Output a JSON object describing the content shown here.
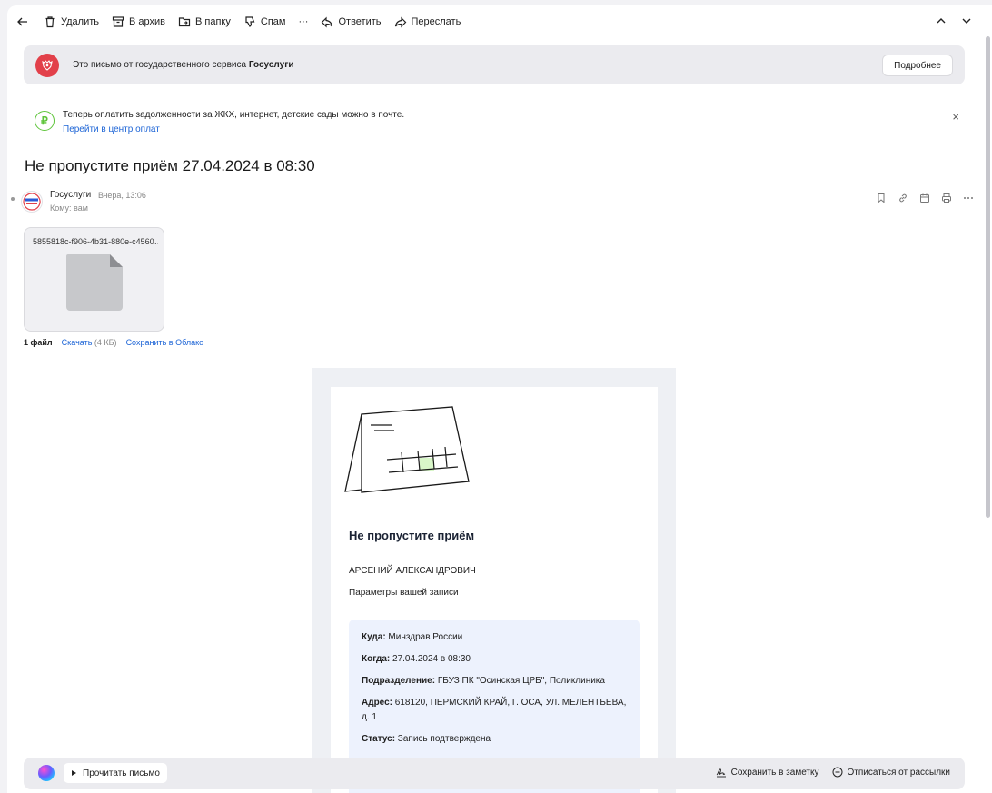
{
  "toolbar": {
    "delete": "Удалить",
    "archive": "В архив",
    "to_folder": "В папку",
    "spam": "Спам",
    "more": "···",
    "reply": "Ответить",
    "forward": "Переслать"
  },
  "gos_banner": {
    "text_prefix": "Это письмо от государственного сервиса",
    "text_brand": "Госуслуги",
    "more_button": "Подробнее"
  },
  "pay_banner": {
    "text": "Теперь оплатить задолженности за ЖКХ, интернет, детские сады можно в почте.",
    "link": "Перейти в центр оплат",
    "close": "×",
    "icon_glyph": "₽"
  },
  "subject": "Не пропустите приём 27.04.2024 в 08:30",
  "sender": {
    "name": "Госуслуги",
    "time": "Вчера, 13:06",
    "to": "Кому: вам"
  },
  "attachment": {
    "filename": "5855818c-f906-4b31-880e-c4560…",
    "count": "1 файл",
    "download": "Скачать",
    "size": "(4 КБ)",
    "save_cloud": "Сохранить в Облако"
  },
  "mail": {
    "title": "Не пропустите приём",
    "name": "АРСЕНИЙ АЛЕКСАНДРОВИЧ",
    "params": "Параметры вашей записи",
    "rows": [
      {
        "label": "Куда:",
        "value": " Минздрав России"
      },
      {
        "label": "Когда:",
        "value": " 27.04.2024 в 08:30"
      },
      {
        "label": "Подразделение:",
        "value": " ГБУЗ ПК \"Осинская ЦРБ\", Поликлиника"
      },
      {
        "label": "Адрес:",
        "value": " 618120, ПЕРМСКИЙ КРАЙ, Г. ОСА, УЛ. МЕЛЕНТЬЕВА, д. 1"
      },
      {
        "label": "Статус:",
        "value": " Запись подтверждена"
      }
    ]
  },
  "bottom_bar": {
    "read_aloud": "Прочитать письмо",
    "save_note": "Сохранить в заметку",
    "unsubscribe": "Отписаться от рассылки"
  },
  "colors": {
    "gos_red": "#e2404a",
    "link_blue": "#1c64d6",
    "pay_green": "#5ec43a",
    "info_bg": "#edf2fd"
  }
}
